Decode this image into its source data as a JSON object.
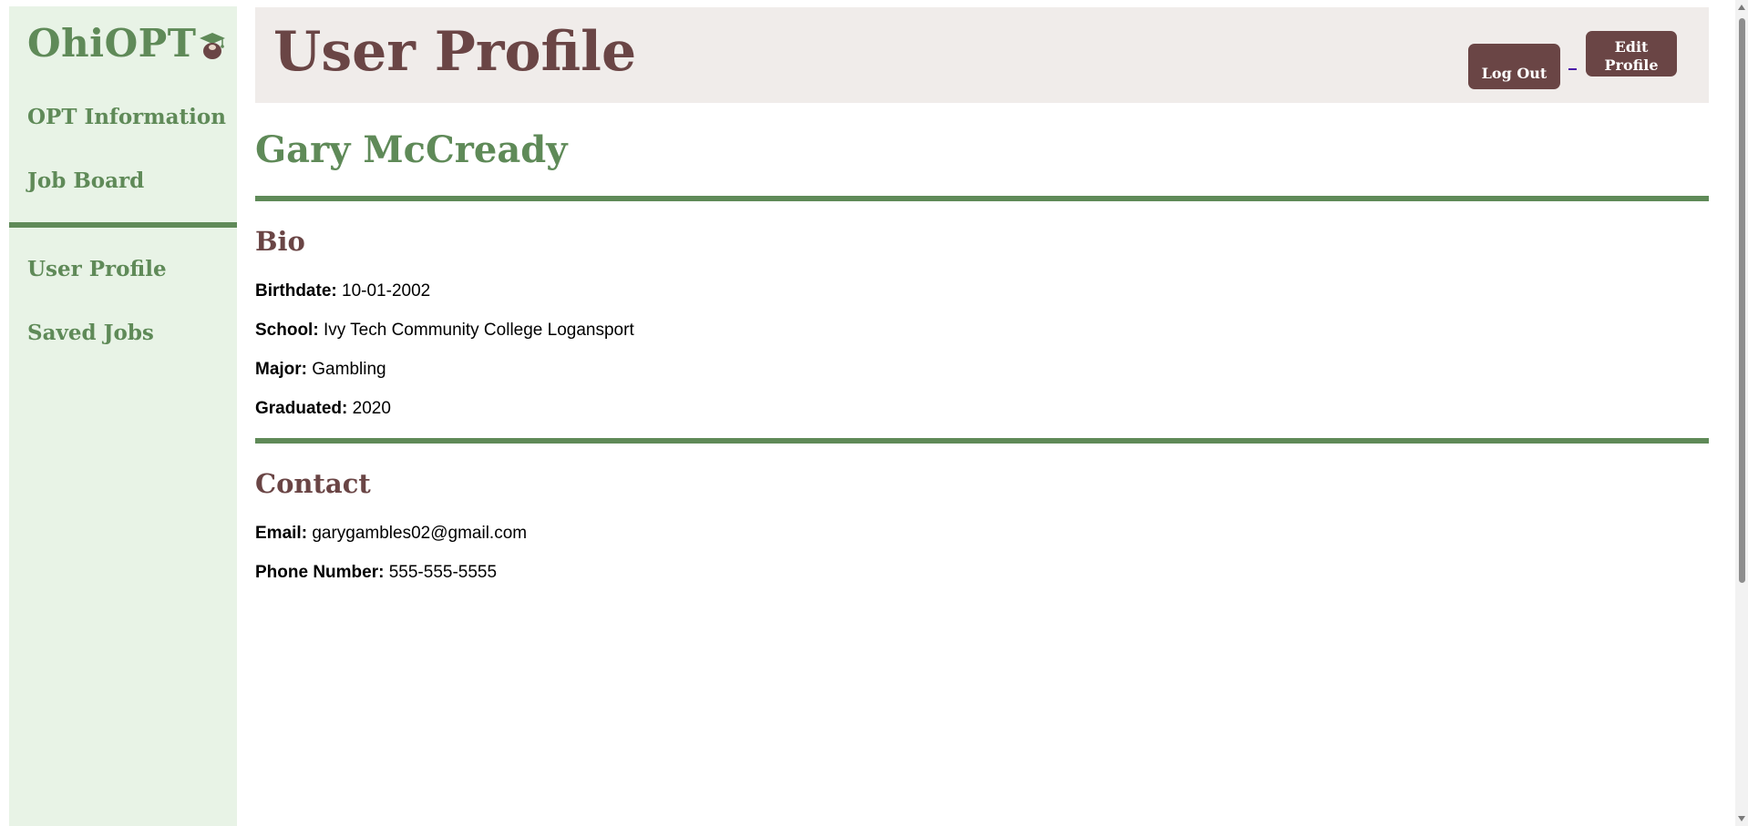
{
  "sidebar": {
    "logo_text": "OhiOPT",
    "logo_icon": "graduation-cap-buckeye-icon",
    "nav_primary": [
      {
        "label": "OPT Information"
      },
      {
        "label": "Job Board"
      }
    ],
    "nav_user": [
      {
        "label": "User Profile"
      },
      {
        "label": "Saved Jobs"
      }
    ]
  },
  "header": {
    "title": "User Profile",
    "logout_label": "Log Out",
    "edit_label_line1": "Edit",
    "edit_label_line2": "Profile"
  },
  "profile": {
    "name": "Gary McCready",
    "bio": {
      "title": "Bio",
      "fields": [
        {
          "label": "Birthdate:",
          "value": "10-01-2002"
        },
        {
          "label": "School:",
          "value": "Ivy Tech Community College Logansport"
        },
        {
          "label": "Major:",
          "value": "Gambling"
        },
        {
          "label": "Graduated:",
          "value": "2020"
        }
      ]
    },
    "contact": {
      "title": "Contact",
      "fields": [
        {
          "label": "Email:",
          "value": "garygambles02@gmail.com"
        },
        {
          "label": "Phone Number:",
          "value": "555-555-5555"
        }
      ]
    }
  },
  "colors": {
    "brand_green": "#5f8a58",
    "brand_brown": "#6a4545",
    "sidebar_bg": "#e8f3e6",
    "header_bg": "#f0ecea"
  }
}
